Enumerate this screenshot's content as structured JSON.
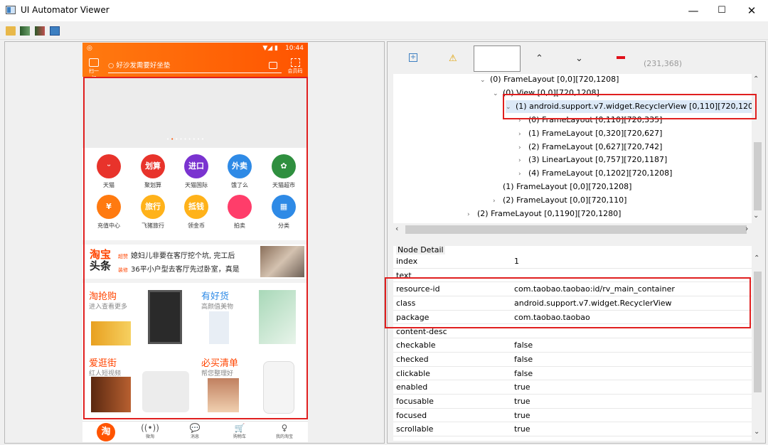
{
  "window": {
    "title": "UI Automator Viewer",
    "minimize": "—",
    "maximize": "☐",
    "close": "✕"
  },
  "phone": {
    "status_time": "10:44",
    "status_signal": "▼◢ ▮",
    "scan_label": "扫一扫",
    "search_placeholder": "好沙发需要好坐垫",
    "member_label": "会员码",
    "grid": [
      {
        "label": "天猫",
        "icon": "ᵕ",
        "color": "#e8332b"
      },
      {
        "label": "聚划算",
        "icon": "划算",
        "color": "#e8332b"
      },
      {
        "label": "天猫国际",
        "icon": "进口",
        "color": "#7a33d0"
      },
      {
        "label": "饿了么",
        "icon": "外卖",
        "color": "#2e8ae6"
      },
      {
        "label": "天猫超市",
        "icon": "✿",
        "color": "#2f8f3f"
      },
      {
        "label": "充值中心",
        "icon": "¥",
        "color": "#ff7a10"
      },
      {
        "label": "飞猪旅行",
        "icon": "旅行",
        "color": "#ffb21a"
      },
      {
        "label": "领金币",
        "icon": "抵钱",
        "color": "#ffb21a"
      },
      {
        "label": "拍卖",
        "icon": "",
        "color": "#ff3d6a"
      },
      {
        "label": "分类",
        "icon": "▦",
        "color": "#2e8ae6"
      }
    ],
    "headline": {
      "logo_a": "淘宝",
      "logo_b": "头条",
      "tag1": "超赞",
      "text1": "媳妇儿非要在客厅挖个坑, 完工后",
      "tag2": "装修",
      "text2": "36平小户型去客厅先过卧室，真是"
    },
    "cards": [
      {
        "title": "淘抢购",
        "sub": "进入查看更多",
        "color": "#ff4400"
      },
      {
        "title": "有好货",
        "sub": "高颜值美物",
        "color": "#2e8ae6"
      },
      {
        "title": "爱逛街",
        "sub": "红人短视频",
        "color": "#ff4400"
      },
      {
        "title": "必买清单",
        "sub": "帮您整理好",
        "color": "#ff4400"
      }
    ],
    "nav": [
      {
        "label": "",
        "icon": "淘"
      },
      {
        "label": "微淘",
        "icon": "((•))"
      },
      {
        "label": "消息",
        "icon": "💬"
      },
      {
        "label": "购物车",
        "icon": "🛒"
      },
      {
        "label": "我的淘宝",
        "icon": "♀"
      }
    ]
  },
  "tree_toolbar": {
    "coord": "(231,368)"
  },
  "tree": [
    {
      "text": "(0) FrameLayout [0,0][720,1208]",
      "arrow": "⌄"
    },
    {
      "text": "(0) View [0,0][720,1208]",
      "arrow": "⌄"
    },
    {
      "text": "(1) android.support.v7.widget.RecyclerView [0,110][720,120",
      "arrow": "⌄"
    },
    {
      "text": "(0) FrameLayout [0,110][720,335]",
      "arrow": "›"
    },
    {
      "text": "(1) FrameLayout [0,320][720,627]",
      "arrow": "›"
    },
    {
      "text": "(2) FrameLayout [0,627][720,742]",
      "arrow": "›"
    },
    {
      "text": "(3) LinearLayout [0,757][720,1187]",
      "arrow": "›"
    },
    {
      "text": "(4) FrameLayout [0,1202][720,1208]",
      "arrow": "›"
    },
    {
      "text": "(1) FrameLayout [0,0][720,1208]",
      "arrow": ""
    },
    {
      "text": "(2) FrameLayout [0,0][720,110]",
      "arrow": "›"
    },
    {
      "text": "(2) FrameLayout [0,1190][720,1280]",
      "arrow": "›"
    }
  ],
  "node_detail": {
    "label": "Node Detail",
    "rows": [
      {
        "k": "index",
        "v": "1"
      },
      {
        "k": "text",
        "v": ""
      },
      {
        "k": "resource-id",
        "v": "com.taobao.taobao:id/rv_main_container"
      },
      {
        "k": "class",
        "v": "android.support.v7.widget.RecyclerView"
      },
      {
        "k": "package",
        "v": "com.taobao.taobao"
      },
      {
        "k": "content-desc",
        "v": ""
      },
      {
        "k": "checkable",
        "v": "false"
      },
      {
        "k": "checked",
        "v": "false"
      },
      {
        "k": "clickable",
        "v": "false"
      },
      {
        "k": "enabled",
        "v": "true"
      },
      {
        "k": "focusable",
        "v": "true"
      },
      {
        "k": "focused",
        "v": "true"
      },
      {
        "k": "scrollable",
        "v": "true"
      }
    ]
  }
}
